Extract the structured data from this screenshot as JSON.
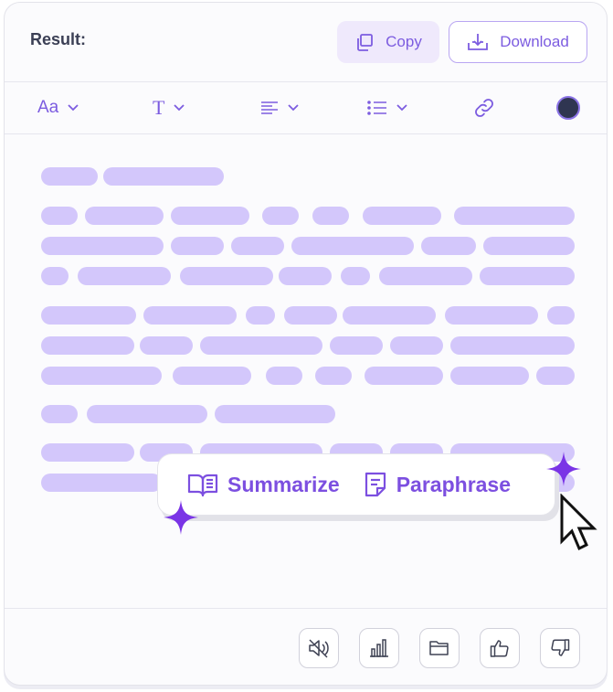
{
  "header": {
    "result_label": "Result:",
    "copy_label": "Copy",
    "download_label": "Download"
  },
  "toolbar": {
    "font_label": "Aa",
    "text_style_label": "T",
    "color_value": "#2f3551"
  },
  "popup": {
    "summarize_label": "Summarize",
    "paraphrase_label": "Paraphrase"
  },
  "colors": {
    "accent": "#7c5ce0",
    "placeholder_text": "#d3c7fb",
    "sparkle": "#7a34e6"
  },
  "icons": {
    "copy": "copy-icon",
    "download": "download-icon",
    "summarize": "book-open-icon",
    "paraphrase": "document-edit-icon",
    "footer": [
      "speaker-mute-icon",
      "bar-chart-icon",
      "folder-icon",
      "thumbs-up-icon",
      "thumbs-down-icon"
    ]
  }
}
